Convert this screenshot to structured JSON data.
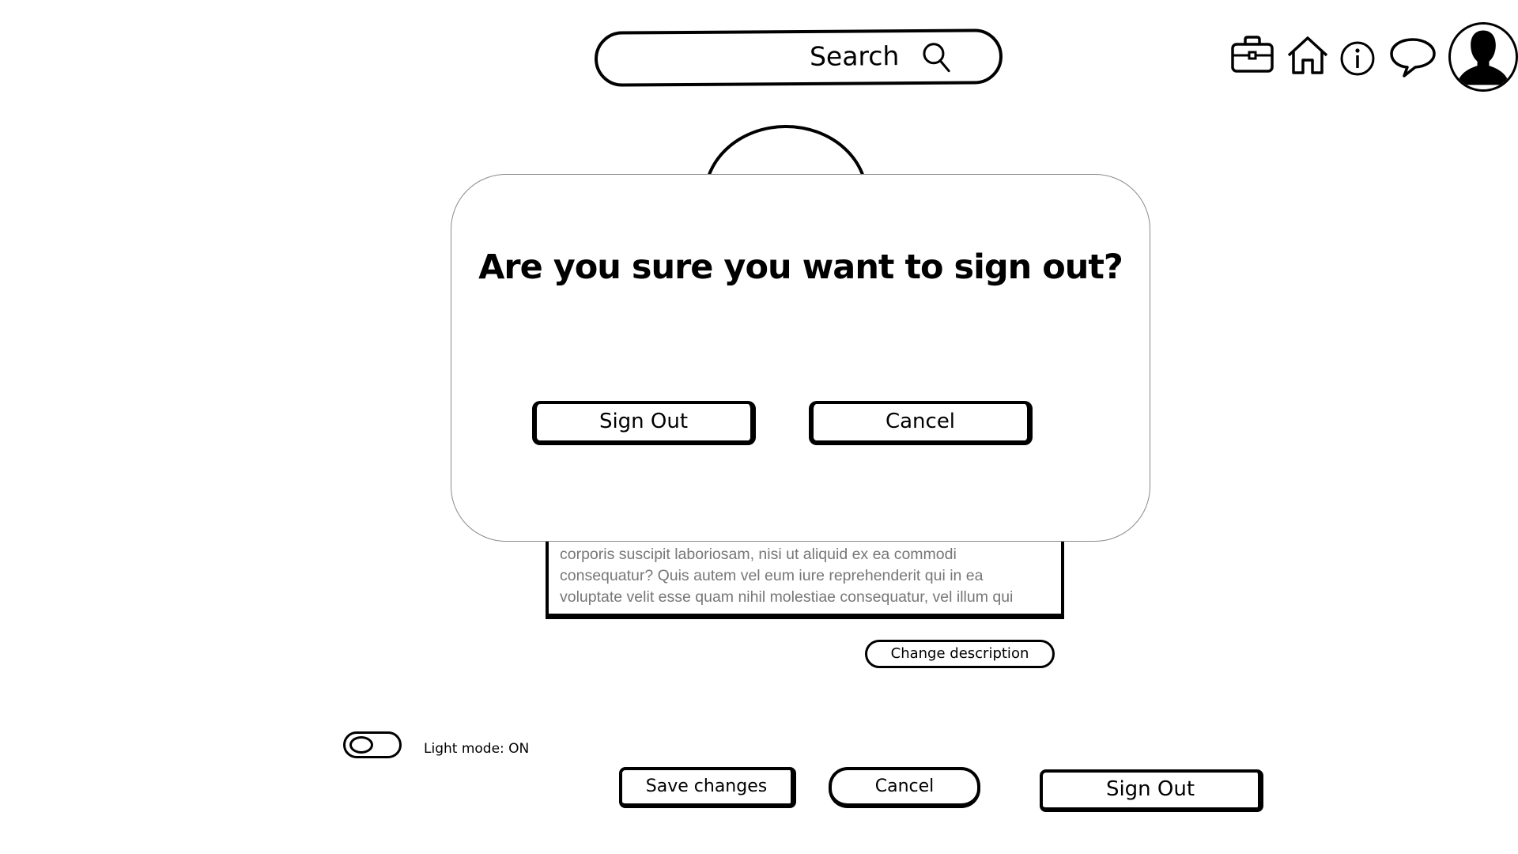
{
  "header": {
    "search_label": "Search",
    "icons": [
      "briefcase-icon",
      "home-icon",
      "info-icon",
      "chat-icon",
      "avatar"
    ]
  },
  "profile": {
    "description_lines": [
      "corporis suscipit laboriosam, nisi ut aliquid ex ea commodi",
      "consequatur? Quis autem vel eum iure reprehenderit qui in ea",
      "voluptate velit esse quam nihil molestiae consequatur, vel illum qui"
    ],
    "change_description_label": "Change description"
  },
  "settings": {
    "light_mode_label": "Light mode: ON",
    "light_mode_on": true
  },
  "actions": {
    "save_label": "Save changes",
    "cancel_label": "Cancel",
    "sign_out_label": "Sign Out"
  },
  "modal": {
    "title": "Are you sure you want to sign out?",
    "confirm_label": "Sign Out",
    "cancel_label": "Cancel"
  }
}
